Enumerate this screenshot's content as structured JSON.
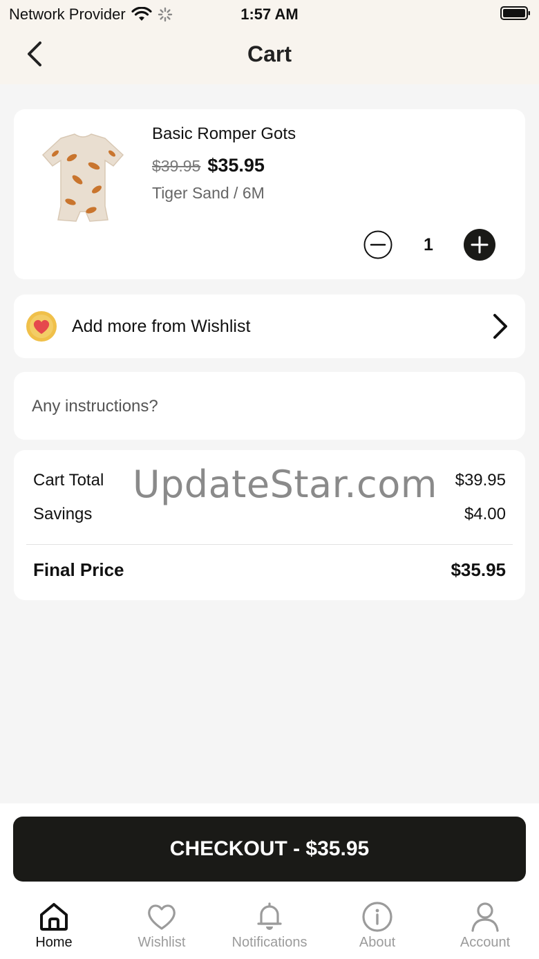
{
  "status_bar": {
    "carrier": "Network Provider",
    "time": "1:57 AM"
  },
  "header": {
    "title": "Cart"
  },
  "cart_item": {
    "name": "Basic Romper Gots",
    "original_price": "$39.95",
    "price": "$35.95",
    "variant": "Tiger Sand / 6M",
    "quantity": "1"
  },
  "wishlist_link": {
    "label": "Add more from Wishlist"
  },
  "instructions": {
    "placeholder": "Any instructions?"
  },
  "summary": {
    "cart_total_label": "Cart Total",
    "cart_total_value": "$39.95",
    "savings_label": "Savings",
    "savings_value": "$4.00",
    "final_label": "Final Price",
    "final_value": "$35.95"
  },
  "watermark": "UpdateStar.com",
  "checkout": {
    "label": "CHECKOUT - $35.95"
  },
  "tabs": [
    {
      "label": "Home",
      "icon": "home-icon",
      "active": true
    },
    {
      "label": "Wishlist",
      "icon": "heart-icon",
      "active": false
    },
    {
      "label": "Notifications",
      "icon": "bell-icon",
      "active": false
    },
    {
      "label": "About",
      "icon": "info-icon",
      "active": false
    },
    {
      "label": "Account",
      "icon": "user-icon",
      "active": false
    }
  ],
  "colors": {
    "header_bg": "#f8f4ee",
    "page_bg": "#f5f5f5",
    "checkout_bg": "#1a1a17",
    "wishlist_badge": "#f0c04a",
    "heart": "#e5484d",
    "inactive_tab": "#9b9b9b"
  }
}
